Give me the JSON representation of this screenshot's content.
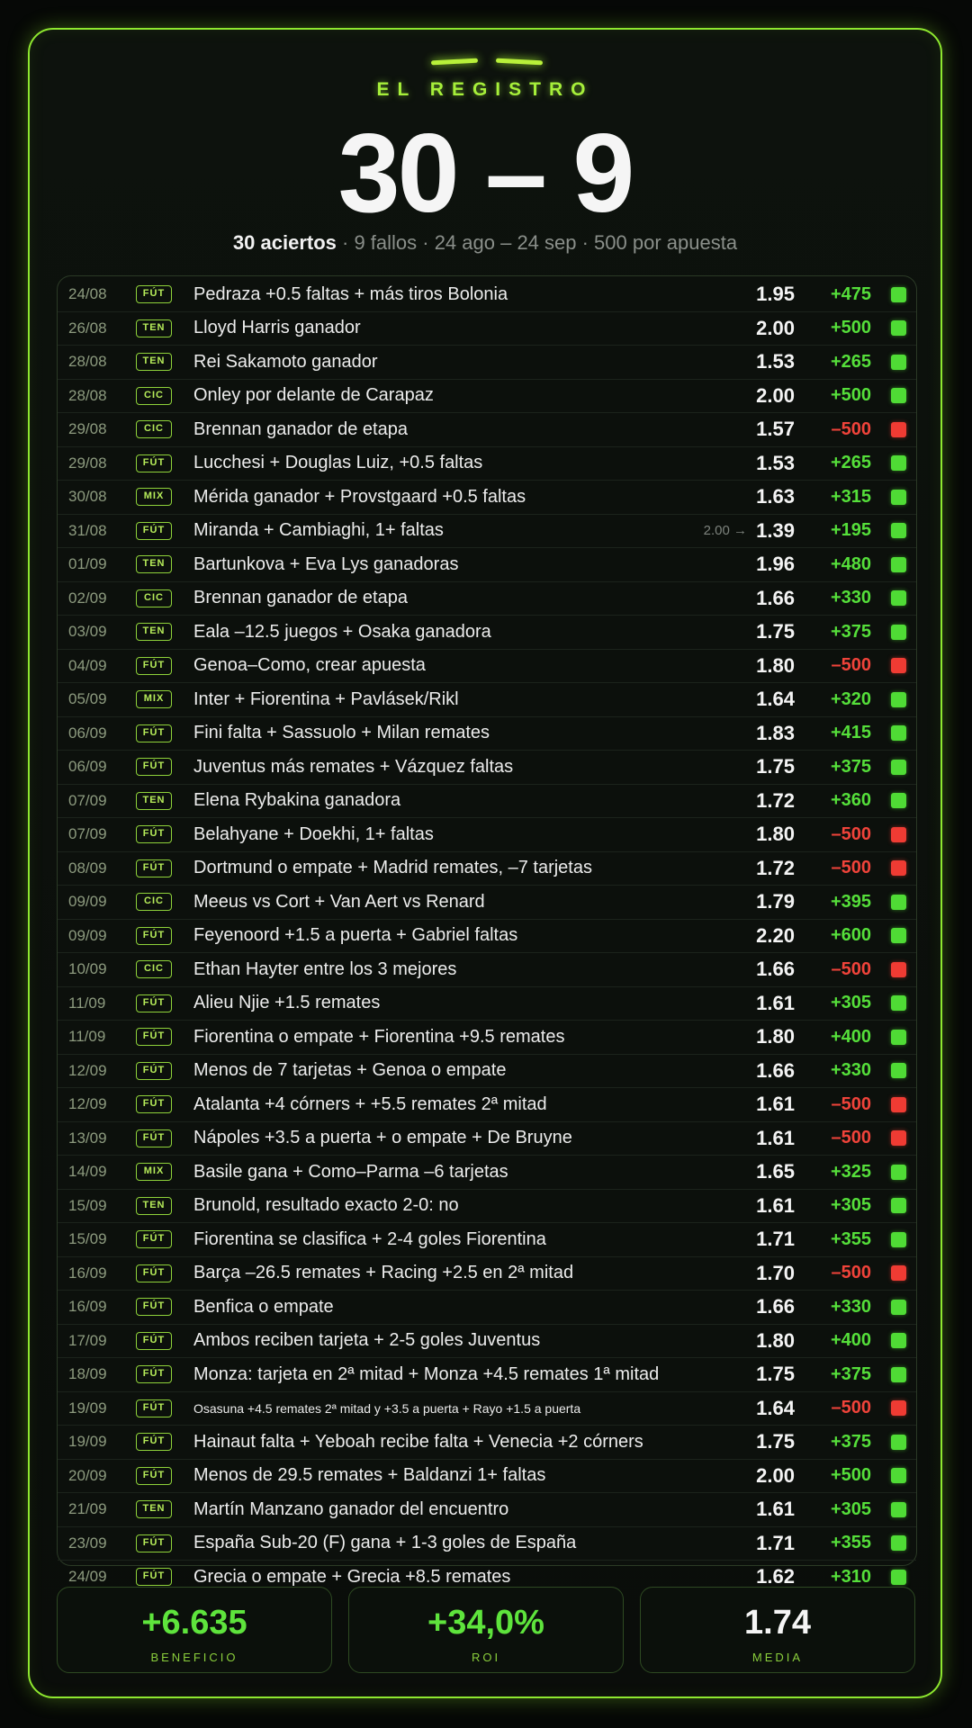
{
  "header": {
    "eyebrow": "EL REGISTRO",
    "score": "30 – 9",
    "summary_bold": "30 aciertos",
    "summary_rest": " · 9 fallos · 24 ago – 24 sep · 500 por apuesta"
  },
  "bets": [
    {
      "date": "24/08",
      "tag": "FÚT",
      "desc": "Pedraza +0.5 faltas + más tiros Bolonia",
      "odds": "1.95",
      "profit": "+475",
      "result": "win"
    },
    {
      "date": "26/08",
      "tag": "TEN",
      "desc": "Lloyd Harris ganador",
      "odds": "2.00",
      "profit": "+500",
      "result": "win"
    },
    {
      "date": "28/08",
      "tag": "TEN",
      "desc": "Rei Sakamoto ganador",
      "odds": "1.53",
      "profit": "+265",
      "result": "win"
    },
    {
      "date": "28/08",
      "tag": "CIC",
      "desc": "Onley por delante de Carapaz",
      "odds": "2.00",
      "profit": "+500",
      "result": "win"
    },
    {
      "date": "29/08",
      "tag": "CIC",
      "desc": "Brennan ganador de etapa",
      "odds": "1.57",
      "profit": "–500",
      "result": "loss"
    },
    {
      "date": "29/08",
      "tag": "FÚT",
      "desc": "Lucchesi + Douglas Luiz, +0.5 faltas",
      "odds": "1.53",
      "profit": "+265",
      "result": "win"
    },
    {
      "date": "30/08",
      "tag": "MIX",
      "desc": "Mérida ganador + Provstgaard +0.5 faltas",
      "odds": "1.63",
      "profit": "+315",
      "result": "win"
    },
    {
      "date": "31/08",
      "tag": "FÚT",
      "desc": "Miranda + Cambiaghi, 1+ faltas",
      "prev": "2.00 →",
      "odds": "1.39",
      "profit": "+195",
      "result": "win"
    },
    {
      "date": "01/09",
      "tag": "TEN",
      "desc": "Bartunkova + Eva Lys ganadoras",
      "odds": "1.96",
      "profit": "+480",
      "result": "win"
    },
    {
      "date": "02/09",
      "tag": "CIC",
      "desc": "Brennan ganador de etapa",
      "odds": "1.66",
      "profit": "+330",
      "result": "win"
    },
    {
      "date": "03/09",
      "tag": "TEN",
      "desc": "Eala –12.5 juegos + Osaka ganadora",
      "odds": "1.75",
      "profit": "+375",
      "result": "win"
    },
    {
      "date": "04/09",
      "tag": "FÚT",
      "desc": "Genoa–Como, crear apuesta",
      "odds": "1.80",
      "profit": "–500",
      "result": "loss"
    },
    {
      "date": "05/09",
      "tag": "MIX",
      "desc": "Inter + Fiorentina + Pavlásek/Rikl",
      "odds": "1.64",
      "profit": "+320",
      "result": "win"
    },
    {
      "date": "06/09",
      "tag": "FÚT",
      "desc": "Fini falta + Sassuolo + Milan remates",
      "odds": "1.83",
      "profit": "+415",
      "result": "win"
    },
    {
      "date": "06/09",
      "tag": "FÚT",
      "desc": "Juventus más remates + Vázquez faltas",
      "odds": "1.75",
      "profit": "+375",
      "result": "win"
    },
    {
      "date": "07/09",
      "tag": "TEN",
      "desc": "Elena Rybakina ganadora",
      "odds": "1.72",
      "profit": "+360",
      "result": "win"
    },
    {
      "date": "07/09",
      "tag": "FÚT",
      "desc": "Belahyane + Doekhi, 1+ faltas",
      "odds": "1.80",
      "profit": "–500",
      "result": "loss"
    },
    {
      "date": "08/09",
      "tag": "FÚT",
      "desc": "Dortmund o empate + Madrid remates, –7 tarjetas",
      "odds": "1.72",
      "profit": "–500",
      "result": "loss"
    },
    {
      "date": "09/09",
      "tag": "CIC",
      "desc": "Meeus vs Cort + Van Aert vs Renard",
      "odds": "1.79",
      "profit": "+395",
      "result": "win"
    },
    {
      "date": "09/09",
      "tag": "FÚT",
      "desc": "Feyenoord +1.5 a puerta + Gabriel faltas",
      "odds": "2.20",
      "profit": "+600",
      "result": "win"
    },
    {
      "date": "10/09",
      "tag": "CIC",
      "desc": "Ethan Hayter entre los 3 mejores",
      "odds": "1.66",
      "profit": "–500",
      "result": "loss"
    },
    {
      "date": "11/09",
      "tag": "FÚT",
      "desc": "Alieu Njie +1.5 remates",
      "odds": "1.61",
      "profit": "+305",
      "result": "win"
    },
    {
      "date": "11/09",
      "tag": "FÚT",
      "desc": "Fiorentina o empate + Fiorentina +9.5 remates",
      "odds": "1.80",
      "profit": "+400",
      "result": "win"
    },
    {
      "date": "12/09",
      "tag": "FÚT",
      "desc": "Menos de 7 tarjetas + Genoa o empate",
      "odds": "1.66",
      "profit": "+330",
      "result": "win"
    },
    {
      "date": "12/09",
      "tag": "FÚT",
      "desc": "Atalanta +4 córners + +5.5 remates 2ª mitad",
      "odds": "1.61",
      "profit": "–500",
      "result": "loss"
    },
    {
      "date": "13/09",
      "tag": "FÚT",
      "desc": "Nápoles +3.5 a puerta + o empate + De Bruyne",
      "odds": "1.61",
      "profit": "–500",
      "result": "loss"
    },
    {
      "date": "14/09",
      "tag": "MIX",
      "desc": "Basile gana + Como–Parma –6 tarjetas",
      "odds": "1.65",
      "profit": "+325",
      "result": "win"
    },
    {
      "date": "15/09",
      "tag": "TEN",
      "desc": "Brunold, resultado exacto 2-0: no",
      "odds": "1.61",
      "profit": "+305",
      "result": "win"
    },
    {
      "date": "15/09",
      "tag": "FÚT",
      "desc": "Fiorentina se clasifica + 2-4 goles Fiorentina",
      "odds": "1.71",
      "profit": "+355",
      "result": "win"
    },
    {
      "date": "16/09",
      "tag": "FÚT",
      "desc": "Barça –26.5 remates + Racing +2.5 en 2ª mitad",
      "odds": "1.70",
      "profit": "–500",
      "result": "loss"
    },
    {
      "date": "16/09",
      "tag": "FÚT",
      "desc": "Benfica o empate",
      "odds": "1.66",
      "profit": "+330",
      "result": "win"
    },
    {
      "date": "17/09",
      "tag": "FÚT",
      "desc": "Ambos reciben tarjeta + 2-5 goles Juventus",
      "odds": "1.80",
      "profit": "+400",
      "result": "win"
    },
    {
      "date": "18/09",
      "tag": "FÚT",
      "desc": "Monza: tarjeta en 2ª mitad + Monza +4.5 remates 1ª mitad",
      "odds": "1.75",
      "profit": "+375",
      "result": "win"
    },
    {
      "date": "19/09",
      "tag": "FÚT",
      "desc": "Osasuna +4.5 remates 2ª mitad y +3.5 a puerta + Rayo +1.5 a puerta",
      "small": true,
      "odds": "1.64",
      "profit": "–500",
      "result": "loss"
    },
    {
      "date": "19/09",
      "tag": "FÚT",
      "desc": "Hainaut falta + Yeboah recibe falta + Venecia +2 córners",
      "odds": "1.75",
      "profit": "+375",
      "result": "win"
    },
    {
      "date": "20/09",
      "tag": "FÚT",
      "desc": "Menos de 29.5 remates + Baldanzi 1+ faltas",
      "odds": "2.00",
      "profit": "+500",
      "result": "win"
    },
    {
      "date": "21/09",
      "tag": "TEN",
      "desc": "Martín Manzano ganador del encuentro",
      "odds": "1.61",
      "profit": "+305",
      "result": "win"
    },
    {
      "date": "23/09",
      "tag": "FÚT",
      "desc": "España Sub-20 (F) gana + 1-3 goles de España",
      "odds": "1.71",
      "profit": "+355",
      "result": "win"
    },
    {
      "date": "24/09",
      "tag": "FÚT",
      "desc": "Grecia o empate + Grecia +8.5 remates",
      "odds": "1.62",
      "profit": "+310",
      "result": "win"
    }
  ],
  "stats": {
    "profit": {
      "value": "+6.635",
      "label": "BENEFICIO"
    },
    "roi": {
      "value": "+34,0%",
      "label": "ROI"
    },
    "avg": {
      "value": "1.74",
      "label": "MEDIA"
    }
  },
  "colors": {
    "accent": "#8ee82f",
    "win": "#4fdb35",
    "loss": "#ef3b33"
  }
}
